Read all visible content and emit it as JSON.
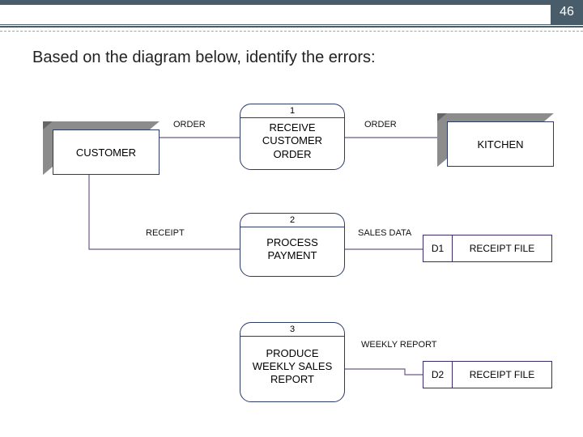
{
  "page": {
    "number": 46
  },
  "title": "Based on the diagram below, identify the errors:",
  "entities": {
    "customer": "CUSTOMER",
    "kitchen": "KITCHEN"
  },
  "processes": [
    {
      "num": "1",
      "label": "RECEIVE CUSTOMER ORDER"
    },
    {
      "num": "2",
      "label": "PROCESS PAYMENT"
    },
    {
      "num": "3",
      "label": "PRODUCE WEEKLY SALES REPORT"
    }
  ],
  "stores": [
    {
      "id": "D1",
      "label": "RECEIPT FILE"
    },
    {
      "id": "D2",
      "label": "RECEIPT FILE"
    }
  ],
  "flows": {
    "customer_to_p1": "ORDER",
    "p1_to_kitchen": "ORDER",
    "p2_to_customer": "RECEIPT",
    "p2_to_d1": "SALES DATA",
    "p3_flow": "WEEKLY REPORT"
  }
}
